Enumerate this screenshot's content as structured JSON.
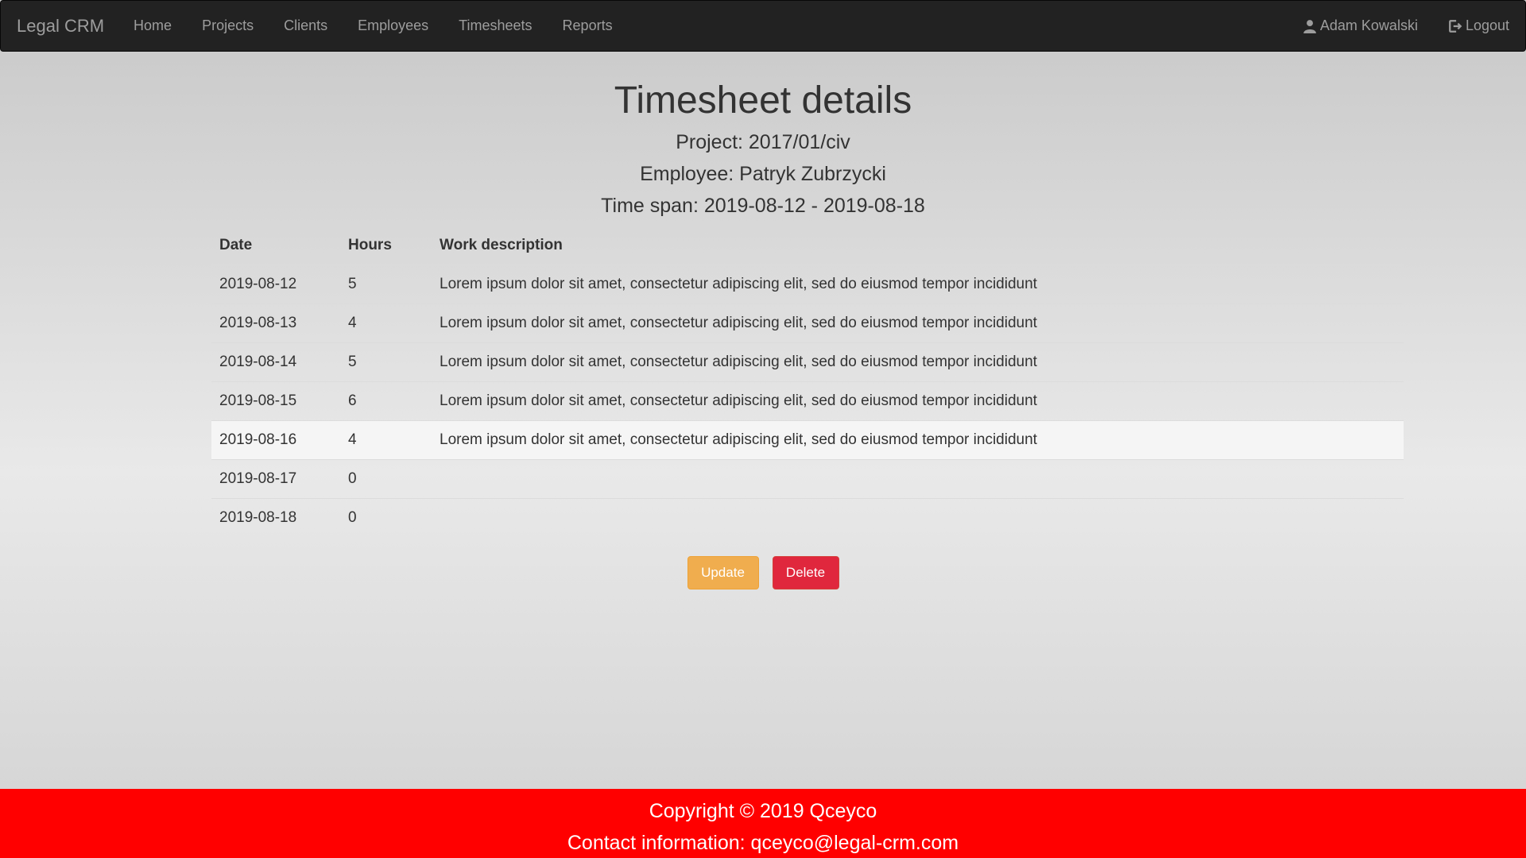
{
  "nav": {
    "brand": "Legal CRM",
    "links": [
      "Home",
      "Projects",
      "Clients",
      "Employees",
      "Timesheets",
      "Reports"
    ],
    "user": "Adam Kowalski",
    "logout": "Logout"
  },
  "header": {
    "title": "Timesheet details",
    "project": "Project: 2017/01/civ",
    "employee": "Employee: Patryk Zubrzycki",
    "time_span": "Time span: 2019-08-12 - 2019-08-18"
  },
  "table": {
    "headers": [
      "Date",
      "Hours",
      "Work description"
    ],
    "rows": [
      {
        "date": "2019-08-12",
        "hours": "5",
        "description": "Lorem ipsum dolor sit amet, consectetur adipiscing elit, sed do eiusmod tempor incididunt"
      },
      {
        "date": "2019-08-13",
        "hours": "4",
        "description": "Lorem ipsum dolor sit amet, consectetur adipiscing elit, sed do eiusmod tempor incididunt"
      },
      {
        "date": "2019-08-14",
        "hours": "5",
        "description": "Lorem ipsum dolor sit amet, consectetur adipiscing elit, sed do eiusmod tempor incididunt"
      },
      {
        "date": "2019-08-15",
        "hours": "6",
        "description": "Lorem ipsum dolor sit amet, consectetur adipiscing elit, sed do eiusmod tempor incididunt"
      },
      {
        "date": "2019-08-16",
        "hours": "4",
        "description": "Lorem ipsum dolor sit amet, consectetur adipiscing elit, sed do eiusmod tempor incididunt"
      },
      {
        "date": "2019-08-17",
        "hours": "0",
        "description": ""
      },
      {
        "date": "2019-08-18",
        "hours": "0",
        "description": ""
      }
    ]
  },
  "actions": {
    "update": "Update",
    "delete": "Delete"
  },
  "footer": {
    "copyright": "Copyright © 2019 Qceyco",
    "contact": "Contact information: qceyco@legal-crm.com"
  },
  "colors": {
    "navbar": "#222222",
    "update_button": "#f0ad4e",
    "delete_button": "#e0273d",
    "footer": "#ff0000"
  },
  "icons": {
    "user": "user-icon",
    "logout": "logout-icon"
  }
}
